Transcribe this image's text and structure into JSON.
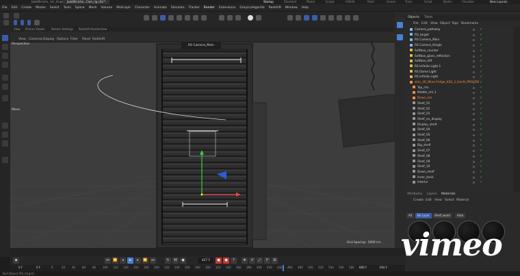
{
  "titlebar": {
    "docs": [
      "JakeWiniche...ter_hinge.c4d",
      "JakeWiniche...Cam_rig.c4d *"
    ],
    "layouts": [
      "Startup",
      "Standard",
      "Model",
      "Sculpt",
      "UVEdit",
      "Paint",
      "Groom",
      "Track",
      "Script",
      "Nodes",
      "Visualize"
    ],
    "new_layouts": "New Layouts"
  },
  "menubar": [
    "File",
    "Edit",
    "Create",
    "Modes",
    "Select",
    "Tools",
    "Spline",
    "Mesh",
    "Volume",
    "MoGraph",
    "Character",
    "Animate",
    "Simulate",
    "Tracker",
    "Render",
    "Extensions",
    "Greyscalegorilla",
    "Redshift",
    "Window",
    "Help"
  ],
  "viewtabs": [
    "View",
    "Picture Viewer",
    "Render Settings",
    "Redshift RenderView"
  ],
  "viewmenu": [
    "View",
    "Cameras",
    "Display",
    "Options",
    "Filter",
    "Panel",
    "Redshift"
  ],
  "viewport": {
    "label": "Perspective",
    "camera": "RS Camera_Main",
    "grid_spacing": "Grid Spacing : 5000 cm",
    "move_label": "Move"
  },
  "objects": {
    "tabs": [
      "Objects",
      "Takes"
    ],
    "menu": [
      "File",
      "Edit",
      "View",
      "Object",
      "Tags",
      "Bookmarks"
    ],
    "rows": [
      {
        "name": "Camera_pathway",
        "color": "#7fc0ff"
      },
      {
        "name": "RS_target",
        "color": "#7fc0ff"
      },
      {
        "name": "RS Camera_Main",
        "color": "#7fc0ff"
      },
      {
        "name": "RS Camera_Hingle",
        "color": "#7fc0ff"
      },
      {
        "name": "Softbox_counter",
        "color": "#e0c040"
      },
      {
        "name": "Softbox_glass_reflection",
        "color": "#e0c040"
      },
      {
        "name": "Softbox_left",
        "color": "#e0c040"
      },
      {
        "name": "RS Infinite Light.1",
        "color": "#e0c040"
      },
      {
        "name": "RS Dome Light",
        "color": "#e0c040"
      },
      {
        "name": "RS Infinite Light",
        "color": "#e0c040"
      },
      {
        "name": "slim_3D_Wine-Fridge_KSS_3_Gerät_PROGRE",
        "color": "#ff8c40",
        "selected": true
      },
      {
        "name": "Top_rim",
        "color": "#ff8c40"
      },
      {
        "name": "Middle_rim.1",
        "color": "#ff8c40"
      },
      {
        "name": "Down_rim",
        "color": "#ff8c40",
        "selected": true
      },
      {
        "name": "Shelf_01",
        "color": "#9a9a9a"
      },
      {
        "name": "Shelf_02",
        "color": "#9a9a9a"
      },
      {
        "name": "Shelf_03",
        "color": "#9a9a9a"
      },
      {
        "name": "Shelf_on_display",
        "color": "#9a9a9a"
      },
      {
        "name": "Display_shelf",
        "color": "#9a9a9a"
      },
      {
        "name": "Shelf_04",
        "color": "#9a9a9a"
      },
      {
        "name": "Shelf_05",
        "color": "#9a9a9a"
      },
      {
        "name": "Shelf_06",
        "color": "#9a9a9a"
      },
      {
        "name": "Big_shelf",
        "color": "#9a9a9a"
      },
      {
        "name": "Shelf_07",
        "color": "#9a9a9a"
      },
      {
        "name": "Shelf_08",
        "color": "#9a9a9a"
      },
      {
        "name": "Shelf_09",
        "color": "#9a9a9a"
      },
      {
        "name": "Shelf_10",
        "color": "#9a9a9a"
      },
      {
        "name": "Down_shelf",
        "color": "#9a9a9a"
      },
      {
        "name": "Inner_back",
        "color": "#9a9a9a"
      },
      {
        "name": "Interior",
        "color": "#9a9a9a"
      }
    ]
  },
  "materials": {
    "tabs": [
      "Attributes",
      "Layers",
      "Materials"
    ],
    "menu": [
      "Create",
      "Edit",
      "View",
      "Select",
      "Material"
    ],
    "layer_buttons": [
      "All",
      "No Layer",
      "Shelf_wood",
      "Auto"
    ]
  },
  "transport": {
    "frame": "427 F"
  },
  "ruler": {
    "start": "0 F",
    "start2": "0 F",
    "end": "600 F",
    "end2": "600 F",
    "ticks": [
      "0",
      "20",
      "40",
      "60",
      "80",
      "100",
      "120",
      "140",
      "160",
      "180",
      "200",
      "220",
      "240",
      "260",
      "280",
      "300",
      "320",
      "340",
      "360",
      "380",
      "400",
      "420",
      "440",
      "460",
      "480",
      "500",
      "520",
      "540",
      "560",
      "580",
      "600"
    ]
  },
  "status": "Null Object [RS_target]",
  "watermark": "vimeo",
  "colors": {
    "accent": "#4a7fd4",
    "selected": "#ff8c40",
    "check": "#44cc44"
  }
}
